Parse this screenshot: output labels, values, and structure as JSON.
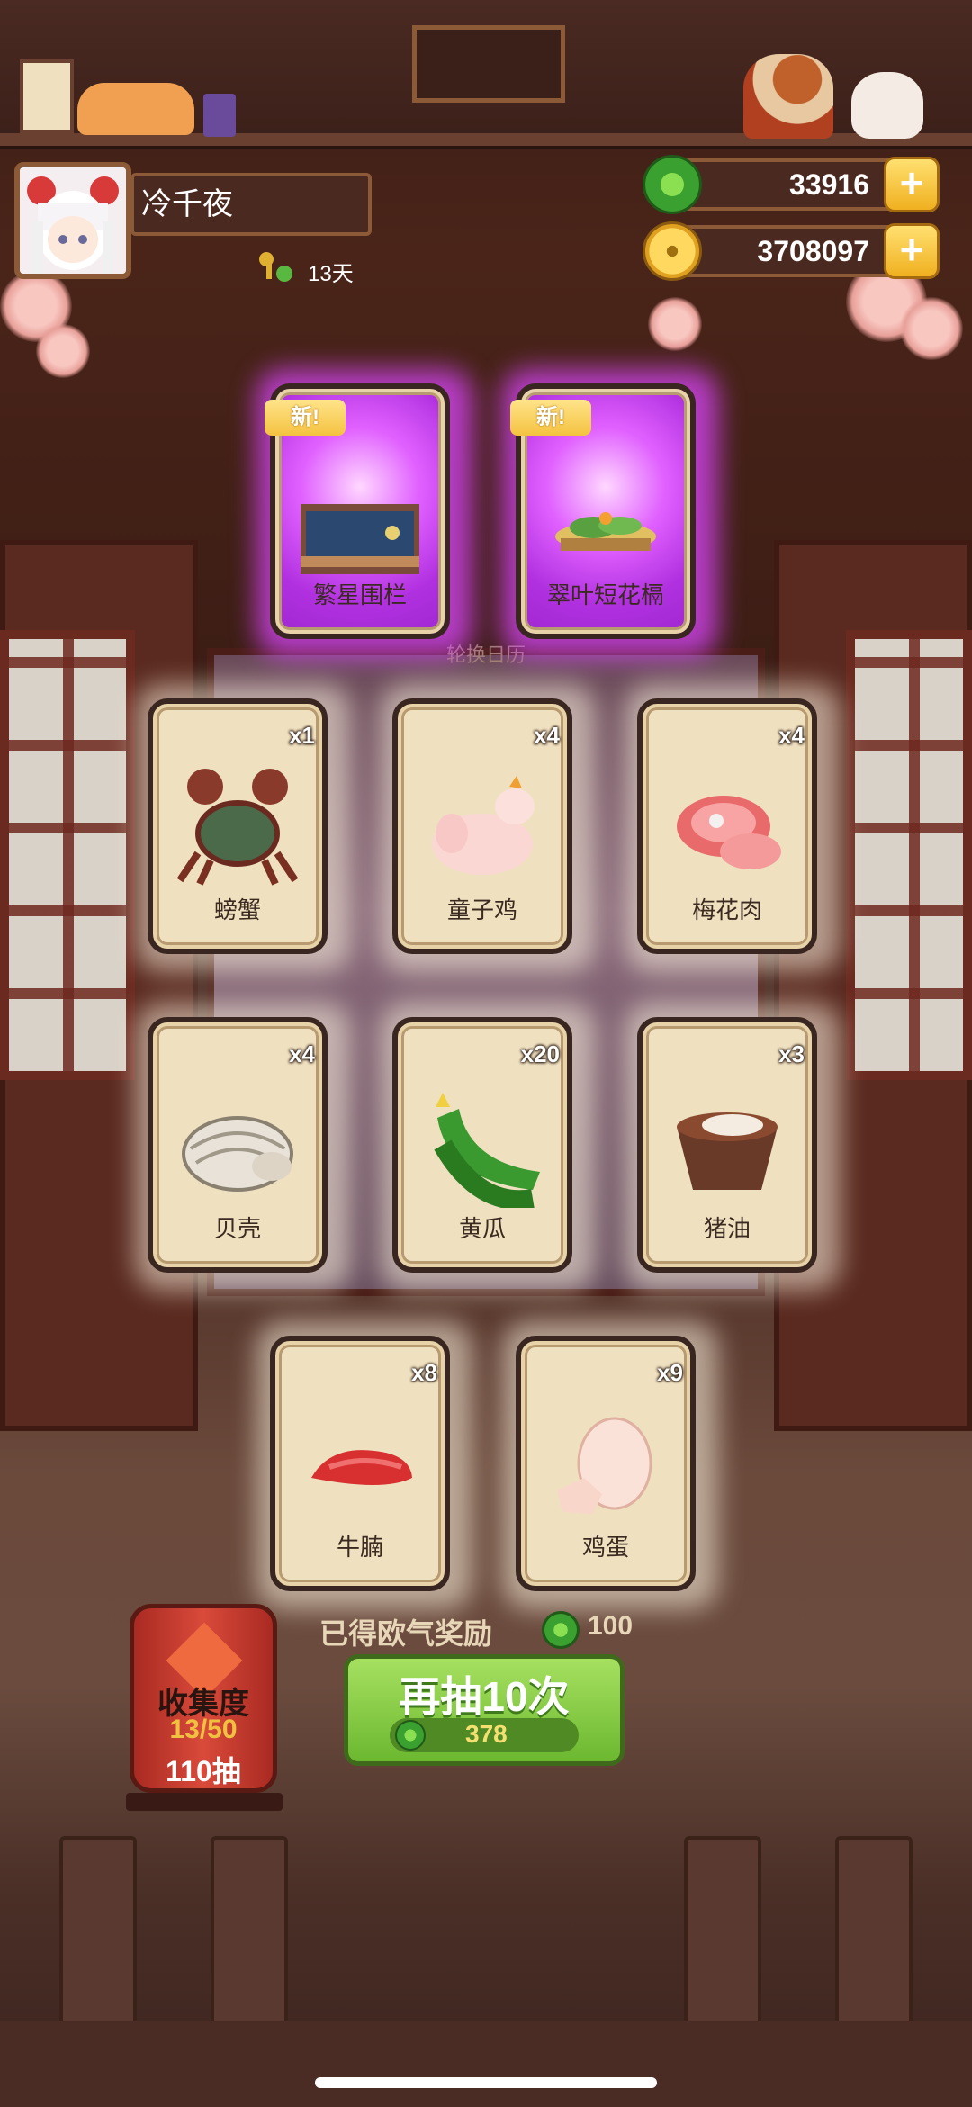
{
  "player": {
    "name": "冷千夜",
    "days": "13天"
  },
  "currency": {
    "jade": "33916",
    "coins": "3708097"
  },
  "scene": {
    "calendar_label": "轮换日历"
  },
  "new_badge": "新",
  "cards_new": [
    {
      "label": "繁星围栏",
      "icon": "fence-furniture-icon"
    },
    {
      "label": "翠叶短花槅",
      "icon": "leaf-planter-icon"
    }
  ],
  "cards": [
    {
      "label": "螃蟹",
      "qty": "x1",
      "icon": "crab-icon"
    },
    {
      "label": "童子鸡",
      "qty": "x4",
      "icon": "chicken-icon"
    },
    {
      "label": "梅花肉",
      "qty": "x4",
      "icon": "pork-icon"
    },
    {
      "label": "贝壳",
      "qty": "x4",
      "icon": "shell-icon"
    },
    {
      "label": "黄瓜",
      "qty": "x20",
      "icon": "cucumber-icon"
    },
    {
      "label": "猪油",
      "qty": "x3",
      "icon": "lard-icon"
    },
    {
      "label": "牛腩",
      "qty": "x8",
      "icon": "beef-icon"
    },
    {
      "label": "鸡蛋",
      "qty": "x9",
      "icon": "egg-icon"
    }
  ],
  "luck_reward": {
    "label": "已得欧气奖励",
    "value": "100"
  },
  "redraw": {
    "label": "再抽10次",
    "cost": "378"
  },
  "collection": {
    "title": "收集度",
    "progress": "13/50",
    "draws": "110抽"
  },
  "colors": {
    "accent_green": "#6cb830",
    "new_purple": "#c040f0",
    "gold": "#f0b020"
  }
}
